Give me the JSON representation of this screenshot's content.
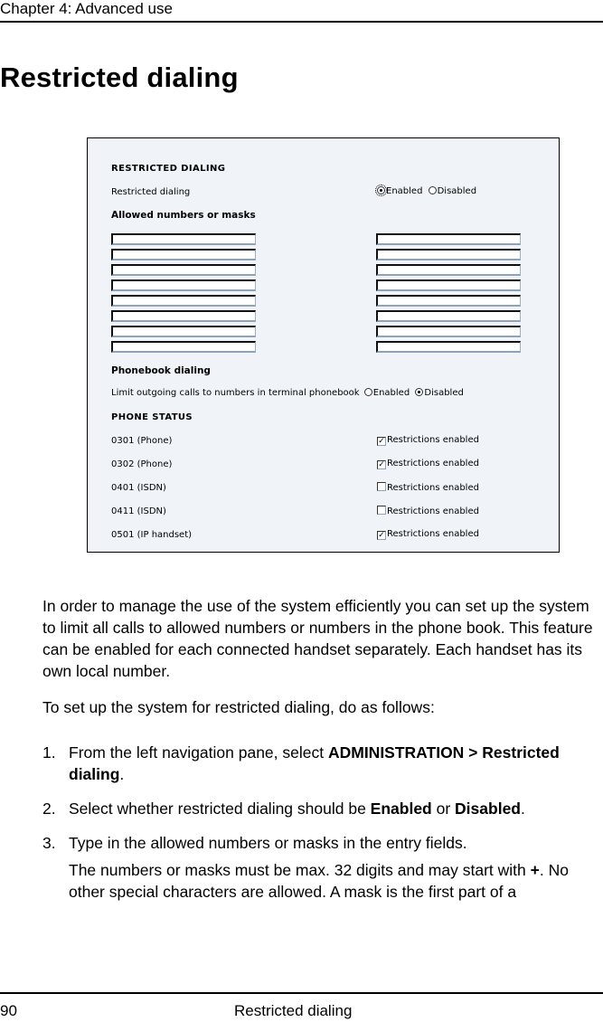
{
  "header": {
    "chapter": "Chapter 4:  Advanced use"
  },
  "title": "Restricted dialing",
  "figure": {
    "section_title": "RESTRICTED DIALING",
    "restricted_dialing": {
      "label": "Restricted dialing",
      "options": [
        "Enabled",
        "Disabled"
      ],
      "selected": "Enabled"
    },
    "allowed_heading": "Allowed numbers or masks",
    "allowed_inputs": {
      "left": [
        "",
        "",
        "",
        "",
        "",
        "",
        "",
        ""
      ],
      "right": [
        "",
        "",
        "",
        "",
        "",
        "",
        "",
        ""
      ]
    },
    "phonebook_heading": "Phonebook dialing",
    "phonebook": {
      "label": "Limit outgoing calls to numbers in terminal phonebook",
      "options": [
        "Enabled",
        "Disabled"
      ],
      "selected": "Disabled"
    },
    "status_title": "PHONE STATUS",
    "phones": [
      {
        "name": "0301 (Phone)",
        "checkbox_label": "Restrictions enabled",
        "checked": true
      },
      {
        "name": "0302 (Phone)",
        "checkbox_label": "Restrictions enabled",
        "checked": true
      },
      {
        "name": "0401 (ISDN)",
        "checkbox_label": "Restrictions enabled",
        "checked": false
      },
      {
        "name": "0411 (ISDN)",
        "checkbox_label": "Restrictions enabled",
        "checked": false
      },
      {
        "name": "0501 (IP handset)",
        "checkbox_label": "Restrictions enabled",
        "checked": true
      }
    ]
  },
  "intro": "In order to manage the use of the system efficiently you can set up the system to limit all calls to allowed numbers or numbers in the phone book. This feature can be enabled for each connected handset separately. Each handset has its own local number.",
  "lead_in": "To set up the system for restricted dialing, do as follows:",
  "steps": [
    {
      "num": "1.",
      "text_before": "From the left navigation pane, select ",
      "bold": "ADMINISTRATION > Restricted dialing",
      "text_after": "."
    },
    {
      "num": "2.",
      "text_before": "Select whether restricted dialing should be ",
      "bold1": "Enabled",
      "mid": " or ",
      "bold2": "Disabled",
      "text_after": "."
    },
    {
      "num": "3.",
      "text": "Type in the allowed numbers or masks in the entry fields.",
      "note_before": "The numbers or masks must be max. 32 digits and may start with ",
      "note_bold": "+",
      "note_after": ". No other special characters are allowed. A mask is the first part of a"
    }
  ],
  "footer": {
    "page_number": "90",
    "section": "Restricted dialing"
  }
}
